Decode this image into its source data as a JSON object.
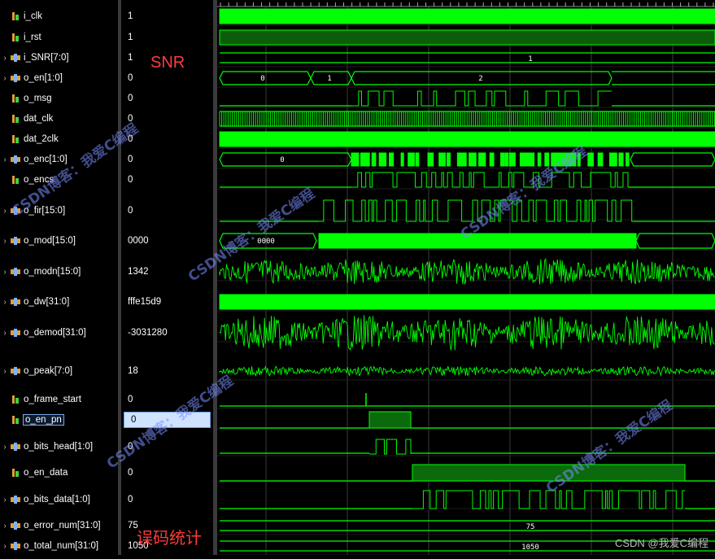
{
  "signals": [
    {
      "name": "i_clk",
      "value": "1",
      "expandable": false,
      "icon": "bit-signal-icon"
    },
    {
      "name": "i_rst",
      "value": "1",
      "expandable": false,
      "icon": "bit-signal-icon"
    },
    {
      "name": "i_SNR[7:0]",
      "value": "1",
      "expandable": true,
      "icon": "bus-signal-icon"
    },
    {
      "name": "o_en[1:0]",
      "value": "0",
      "expandable": true,
      "icon": "bus-signal-icon"
    },
    {
      "name": "o_msg",
      "value": "0",
      "expandable": false,
      "icon": "bit-signal-icon"
    },
    {
      "name": "dat_clk",
      "value": "0",
      "expandable": false,
      "icon": "bit-signal-icon"
    },
    {
      "name": "dat_2clk",
      "value": "0",
      "expandable": false,
      "icon": "bit-signal-icon"
    },
    {
      "name": "o_enc[1:0]",
      "value": "0",
      "expandable": true,
      "icon": "bus-signal-icon"
    },
    {
      "name": "o_encs",
      "value": "0",
      "expandable": false,
      "icon": "bit-signal-icon"
    },
    {
      "name": "o_fir[15:0]",
      "value": "0",
      "expandable": true,
      "icon": "bus-signal-icon"
    },
    {
      "name": "o_mod[15:0]",
      "value": "0000",
      "expandable": true,
      "icon": "bus-signal-icon"
    },
    {
      "name": "o_modn[15:0]",
      "value": "1342",
      "expandable": true,
      "icon": "bus-signal-icon"
    },
    {
      "name": "o_dw[31:0]",
      "value": "fffe15d9",
      "expandable": true,
      "icon": "bus-signal-icon"
    },
    {
      "name": "o_demod[31:0]",
      "value": "-3031280",
      "expandable": true,
      "icon": "bus-signal-icon"
    },
    {
      "name": "o_peak[7:0]",
      "value": "18",
      "expandable": true,
      "icon": "bus-signal-icon"
    },
    {
      "name": "o_frame_start",
      "value": "0",
      "expandable": false,
      "icon": "bit-signal-icon"
    },
    {
      "name": "o_en_pn",
      "value": "0",
      "expandable": false,
      "icon": "bit-signal-icon",
      "selected": true
    },
    {
      "name": "o_bits_head[1:0]",
      "value": "0",
      "expandable": true,
      "icon": "bus-signal-icon"
    },
    {
      "name": "o_en_data",
      "value": "0",
      "expandable": false,
      "icon": "bit-signal-icon"
    },
    {
      "name": "o_bits_data[1:0]",
      "value": "0",
      "expandable": true,
      "icon": "bus-signal-icon"
    },
    {
      "name": "o_error_num[31:0]",
      "value": "75",
      "expandable": true,
      "icon": "bus-signal-icon"
    },
    {
      "name": "o_total_num[31:0]",
      "value": "1050",
      "expandable": true,
      "icon": "bus-signal-icon"
    }
  ],
  "wave_labels": {
    "snr": "1",
    "en": [
      "0",
      "1",
      "2"
    ],
    "enc": "0",
    "mod": "0000",
    "error_num": "75",
    "total_num": "1050"
  },
  "annotations": {
    "snr": "SNR",
    "error_stats": "误码统计"
  },
  "watermark": {
    "text": "CSDN博客：我爱C编程",
    "corner": "CSDN @我爱C编程"
  },
  "colors": {
    "wave": "#00ff00",
    "background": "#000000",
    "annotation": "#ff3b3b",
    "selection": "#cfe3ff"
  }
}
